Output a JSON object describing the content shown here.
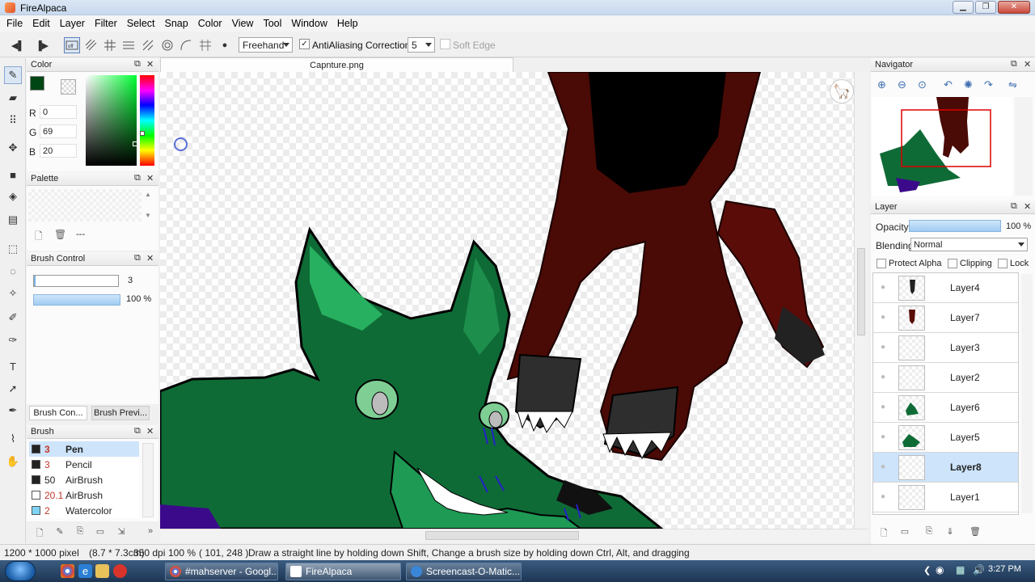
{
  "window": {
    "title": "FireAlpaca"
  },
  "menu": [
    "File",
    "Edit",
    "Layer",
    "Filter",
    "Select",
    "Snap",
    "Color",
    "View",
    "Tool",
    "Window",
    "Help"
  ],
  "toolbar": {
    "mode": "Freehand",
    "antialiasing_label": "AntiAliasing",
    "antialiasing_checked": "✓",
    "correction_label": "Correction",
    "correction_value": "5",
    "soft_edge_label": "Soft Edge"
  },
  "color_panel": {
    "title": "Color",
    "r_label": "R",
    "r_value": "0",
    "g_label": "G",
    "g_value": "69",
    "b_label": "B",
    "b_value": "20",
    "fg": "#004514",
    "bg": "#ffffff"
  },
  "palette_panel": {
    "title": "Palette",
    "dots": "---"
  },
  "brush_control": {
    "title": "Brush Control",
    "size_value": "3",
    "opacity_value": "100 %"
  },
  "brush_tabs": [
    "Brush Con...",
    "Brush Previ..."
  ],
  "brush_panel": {
    "title": "Brush",
    "items": [
      {
        "size": "3",
        "name": "Pen",
        "color": "#222222"
      },
      {
        "size": "3",
        "name": "Pencil",
        "color": "#222222"
      },
      {
        "size": "50",
        "name": "AirBrush",
        "color": "#222222"
      },
      {
        "size": "20.1",
        "name": "AirBrush",
        "color": "#ffffff"
      },
      {
        "size": "2",
        "name": "Watercolor",
        "color": "#7fd4f5"
      }
    ]
  },
  "document": {
    "tab": "Capnture.png"
  },
  "navigator": {
    "title": "Navigator"
  },
  "layer_panel": {
    "title": "Layer",
    "opacity_label": "Opacity",
    "opacity_value": "100 %",
    "blending_label": "Blending",
    "blending_value": "Normal",
    "protect_alpha": "Protect Alpha",
    "clipping": "Clipping",
    "lock": "Lock",
    "layers": [
      {
        "name": "Layer4"
      },
      {
        "name": "Layer7"
      },
      {
        "name": "Layer3"
      },
      {
        "name": "Layer2"
      },
      {
        "name": "Layer6"
      },
      {
        "name": "Layer5"
      },
      {
        "name": "Layer8"
      },
      {
        "name": "Layer1"
      }
    ]
  },
  "status": {
    "size": "1200 * 1000 pixel",
    "cm": "(8.7 * 7.3cm)",
    "dpi": "350 dpi",
    "zoom": "100 %",
    "coords": "( 101, 248 )",
    "hint": "Draw a straight line by holding down Shift, Change a brush size by holding down Ctrl, Alt, and dragging"
  },
  "taskbar": {
    "tasks": [
      "#mahserver - Googl...",
      "FireAlpaca",
      "Screencast-O-Matic..."
    ],
    "clock": "3:27 PM"
  }
}
